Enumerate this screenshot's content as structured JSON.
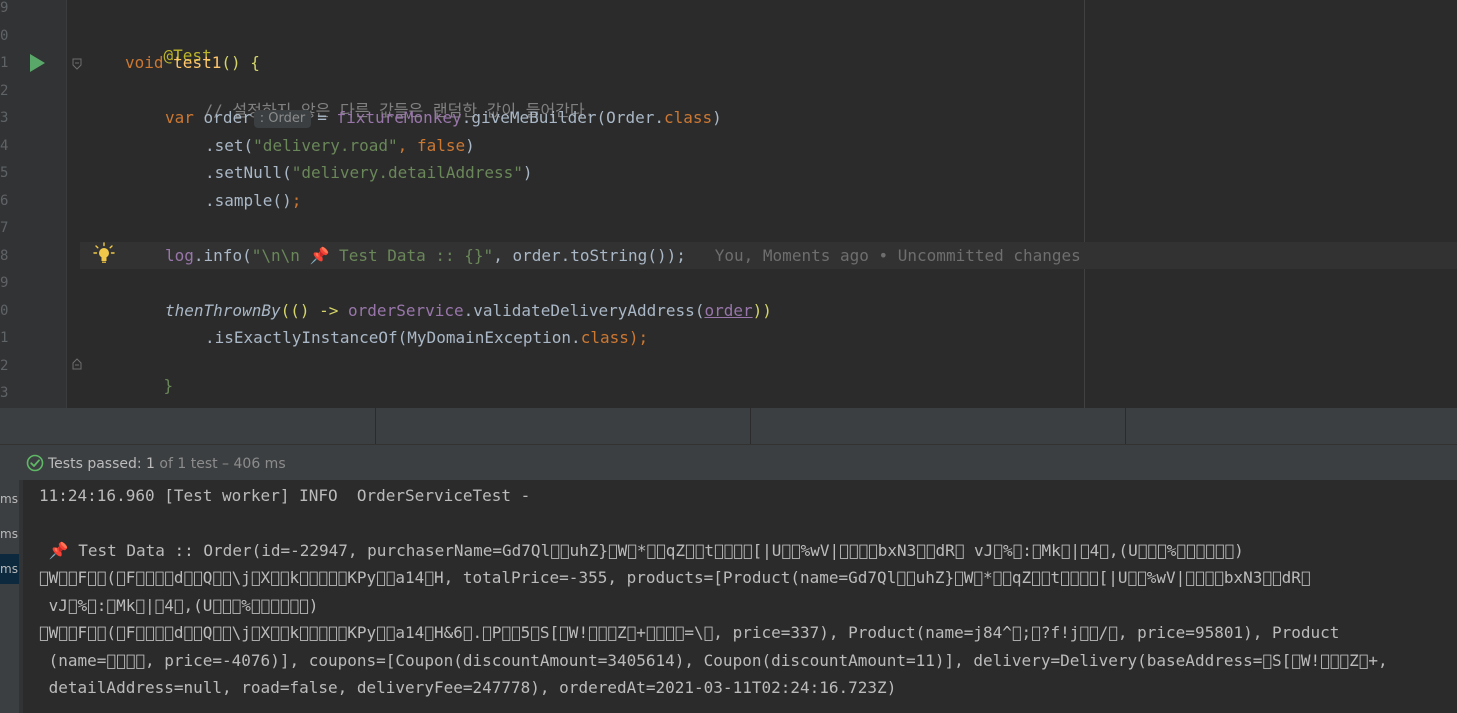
{
  "editor": {
    "line_numbers": [
      "9",
      "0",
      "1",
      "2",
      "3",
      "4",
      "5",
      "6",
      "7",
      "8",
      "9",
      "0",
      "1",
      "2",
      "3"
    ],
    "lines": {
      "annotation": "@Test",
      "void_kw": "void",
      "method_name": "test1",
      "method_sig_rest": "() {",
      "comment": "// 설정하지 않은 다른 값들은 랜덤한 값이 들어간다.",
      "var_kw": "var",
      "var_name": "order",
      "type_hint": ": Order",
      "assign": "= ",
      "field_fixture": "fixtureMonkey",
      "give_me_builder": ".giveMeBuilder(Order.",
      "class_kw": "class",
      "close_paren": ")",
      "set_call": ".set(",
      "set_arg1": "\"delivery.road\"",
      "set_comma": ", ",
      "false_kw": "false",
      "set_null_call": ".setNull(",
      "set_null_arg": "\"delivery.detailAddress\"",
      "sample_call": ".sample()",
      "semicolon": ";",
      "log_field": "log",
      "log_info": ".info(",
      "log_str": "\"\\n\\n 📌 Test Data :: {}\"",
      "log_rest": ", order.toString());",
      "blame": "You, Moments ago • Uncommitted changes",
      "then_thrown": "thenThrownBy",
      "lambda_open": "(() -> ",
      "order_service": "orderService",
      "validate": ".validateDeliveryAddress(",
      "order_ref": "order",
      "validate_close": "))",
      "is_exactly": ".isExactlyInstanceOf(MyDomainException.",
      "is_exactly_close": ");",
      "closing_brace": "}"
    },
    "icons": {
      "run": "run-test-icon",
      "bulb": "lightbulb-icon",
      "fold": "fold-icon"
    }
  },
  "status": {
    "passed_label": "Tests passed: ",
    "passed_count": "1",
    "of_label": " of 1 test – 406 ms",
    "icon": "check-circle-icon"
  },
  "console": {
    "left_items": [
      "ms",
      "ms",
      "ms"
    ],
    "lines": [
      "11:24:16.960 [Test worker] INFO  OrderServiceTest -",
      "",
      " 📌 Test Data :: Order(id=-22947, purchaserName=Gd7Ql\u0000\u0000uhZ}\u0000W\u0000*\u0000\u0000qZ\u0000\u0000t\u0000\u0000\u0000\u0000[|U\u0000\u0000%wV|\u0000\u0000\u0000\u0000bxN3\u0000\u0000dR\u0000 vJ\u0000%\u0000:\u0000Mk\u0000|\u00004\u0000,(U\u0000\u0000\u0000%\u0000\u0000\u0000\u0000\u0000\u0000)",
      "\u0000W\u0000\u0000F\u0000\u0000(\u0000F\u0000\u0000\u0000\u0000d\u0000\u0000Q\u0000\u0000\\j\u0000X\u0000\u0000k\u0000\u0000\u0000\u0000\u0000KPy\u0000\u0000a14\u0000H, totalPrice=-355, products=[Product(name=Gd7Ql\u0000\u0000uhZ}\u0000W\u0000*\u0000\u0000qZ\u0000\u0000t\u0000\u0000\u0000\u0000[|U\u0000\u0000%wV|\u0000\u0000\u0000\u0000bxN3\u0000\u0000dR\u0000",
      " vJ\u0000%\u0000:\u0000Mk\u0000|\u00004\u0000,(U\u0000\u0000\u0000%\u0000\u0000\u0000\u0000\u0000\u0000)",
      "\u0000W\u0000\u0000F\u0000\u0000(\u0000F\u0000\u0000\u0000\u0000d\u0000\u0000Q\u0000\u0000\\j\u0000X\u0000\u0000k\u0000\u0000\u0000\u0000\u0000KPy\u0000\u0000a14\u0000H&6\u0000.\u0000P\u0000\u00005\u0000S[\u0000W!\u0000\u0000\u0000Z\u0000+\u0000\u0000\u0000\u0000=\\\u0000, price=337), Product(name=j84^\u0000;\u0000?f!j\u0000\u0000/\u0000, price=95801), Product",
      " (name=\u0000\u0000\u0000\u0000, price=-4076)], coupons=[Coupon(discountAmount=3405614), Coupon(discountAmount=11)], delivery=Delivery(baseAddress=\u0000S[\u0000W!\u0000\u0000\u0000Z\u0000+,",
      " detailAddress=null, road=false, deliveryFee=247778), orderedAt=2021-03-11T02:24:16.723Z)"
    ]
  }
}
